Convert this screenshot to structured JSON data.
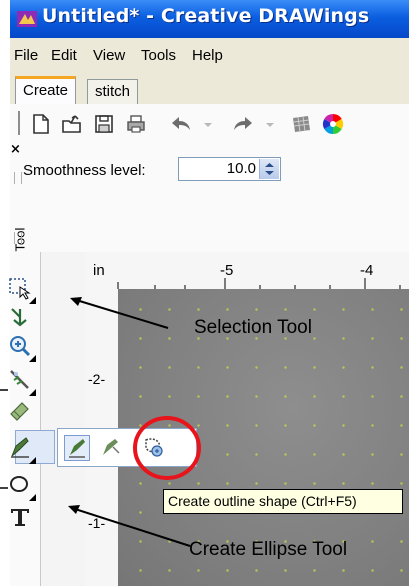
{
  "window": {
    "title": "Untitled* - Creative DRAWings"
  },
  "menu": [
    "File",
    "Edit",
    "View",
    "Tools",
    "Help"
  ],
  "tabs": [
    {
      "label": "Create",
      "active": true
    },
    {
      "label": "stitch",
      "active": false
    }
  ],
  "toolbar": {
    "icons": [
      "new-document-icon",
      "open-icon",
      "save-icon",
      "print-icon",
      "undo-icon",
      "dropdown-arrow-icon",
      "redo-icon",
      "dropdown-arrow-icon",
      "texture-icon",
      "color-wheel-icon"
    ]
  },
  "tool_options": {
    "panel_label": "Tool",
    "smoothness_label": "Smoothness level:",
    "smoothness_value": "10.0"
  },
  "rulers": {
    "unit": "in",
    "top_marks": [
      "-5",
      "-4"
    ],
    "left_marks": [
      "-2-",
      "-1-"
    ]
  },
  "flyout_tooltip": "Create outline shape (Ctrl+F5)",
  "annotations": {
    "selection_tool": "Selection Tool",
    "ellipse_tool": "Create Ellipse Tool"
  },
  "colors": {
    "titlebar": "#0b5fe0",
    "highlight_circle": "#e8141b",
    "canvas": "#808080",
    "tooltip_bg": "#ffffe1"
  }
}
